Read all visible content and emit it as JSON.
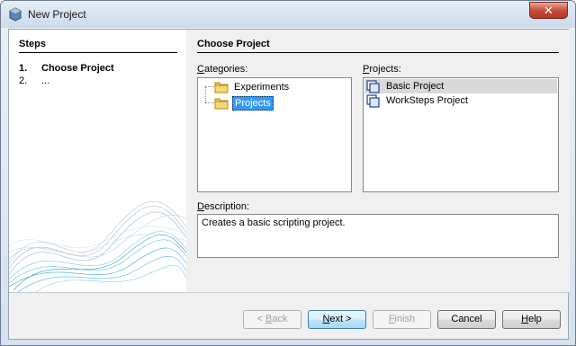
{
  "window": {
    "title": "New Project",
    "close_glyph": "✕"
  },
  "steps": {
    "title": "Steps",
    "items": [
      {
        "num": "1.",
        "label": "Choose Project"
      },
      {
        "num": "2.",
        "label": "..."
      }
    ]
  },
  "main": {
    "title": "Choose Project",
    "categories_label_u": "C",
    "categories_label_rest": "ategories:",
    "projects_label_u": "P",
    "projects_label_rest": "rojects:",
    "description_label_u": "D",
    "description_label_rest": "escription:",
    "categories": [
      {
        "label": "Experiments",
        "icon": "folder-icon",
        "selected": false
      },
      {
        "label": "Projects",
        "icon": "folder-icon",
        "selected": true
      }
    ],
    "projects": [
      {
        "label": "Basic Project",
        "icon": "project-icon",
        "selected": true
      },
      {
        "label": "WorkSteps Project",
        "icon": "project-icon",
        "selected": false
      }
    ],
    "description": "Creates a basic scripting project."
  },
  "buttons": {
    "back_pre": "< ",
    "back_u": "B",
    "back_rest": "ack",
    "next_u": "N",
    "next_rest": "ext >",
    "finish_u": "F",
    "finish_rest": "inish",
    "cancel": "Cancel",
    "help_u": "H",
    "help_rest": "elp"
  }
}
